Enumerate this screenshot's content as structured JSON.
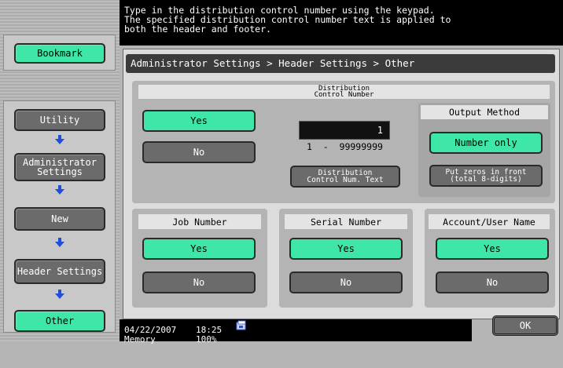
{
  "message": "Type in the distribution control number using the keypad.\nThe specified distribution control number text is applied to\nboth the header and footer.",
  "breadcrumb": "Administrator Settings > Header Settings > Other",
  "sidebar": {
    "bookmark": "Bookmark",
    "items": [
      {
        "label": "Utility"
      },
      {
        "label": "Administrator\nSettings"
      },
      {
        "label": "New"
      },
      {
        "label": "Header Settings"
      },
      {
        "label": "Other"
      }
    ]
  },
  "distribution": {
    "title": "Distribution\nControl Number",
    "yes": "Yes",
    "no": "No",
    "value": "1",
    "range": "1  -  99999999",
    "text_button": "Distribution\nControl Num. Text",
    "output_method": {
      "title": "Output Method",
      "number_only": "Number only",
      "zeros": "Put zeros in front\n(total 8-digits)"
    }
  },
  "job_number": {
    "title": "Job Number",
    "yes": "Yes",
    "no": "No"
  },
  "serial_number": {
    "title": "Serial Number",
    "yes": "Yes",
    "no": "No"
  },
  "account": {
    "title": "Account/User Name",
    "yes": "Yes",
    "no": "No"
  },
  "status": {
    "date": "04/22/2007",
    "time": "18:25",
    "memory_label": "Memory",
    "memory_value": "100%"
  },
  "ok": "OK",
  "colors": {
    "accent": "#3ee6a8",
    "selected_gray": "#6b6b6b"
  },
  "icons": [
    "arrow-down-icon",
    "memory-status-icon"
  ]
}
